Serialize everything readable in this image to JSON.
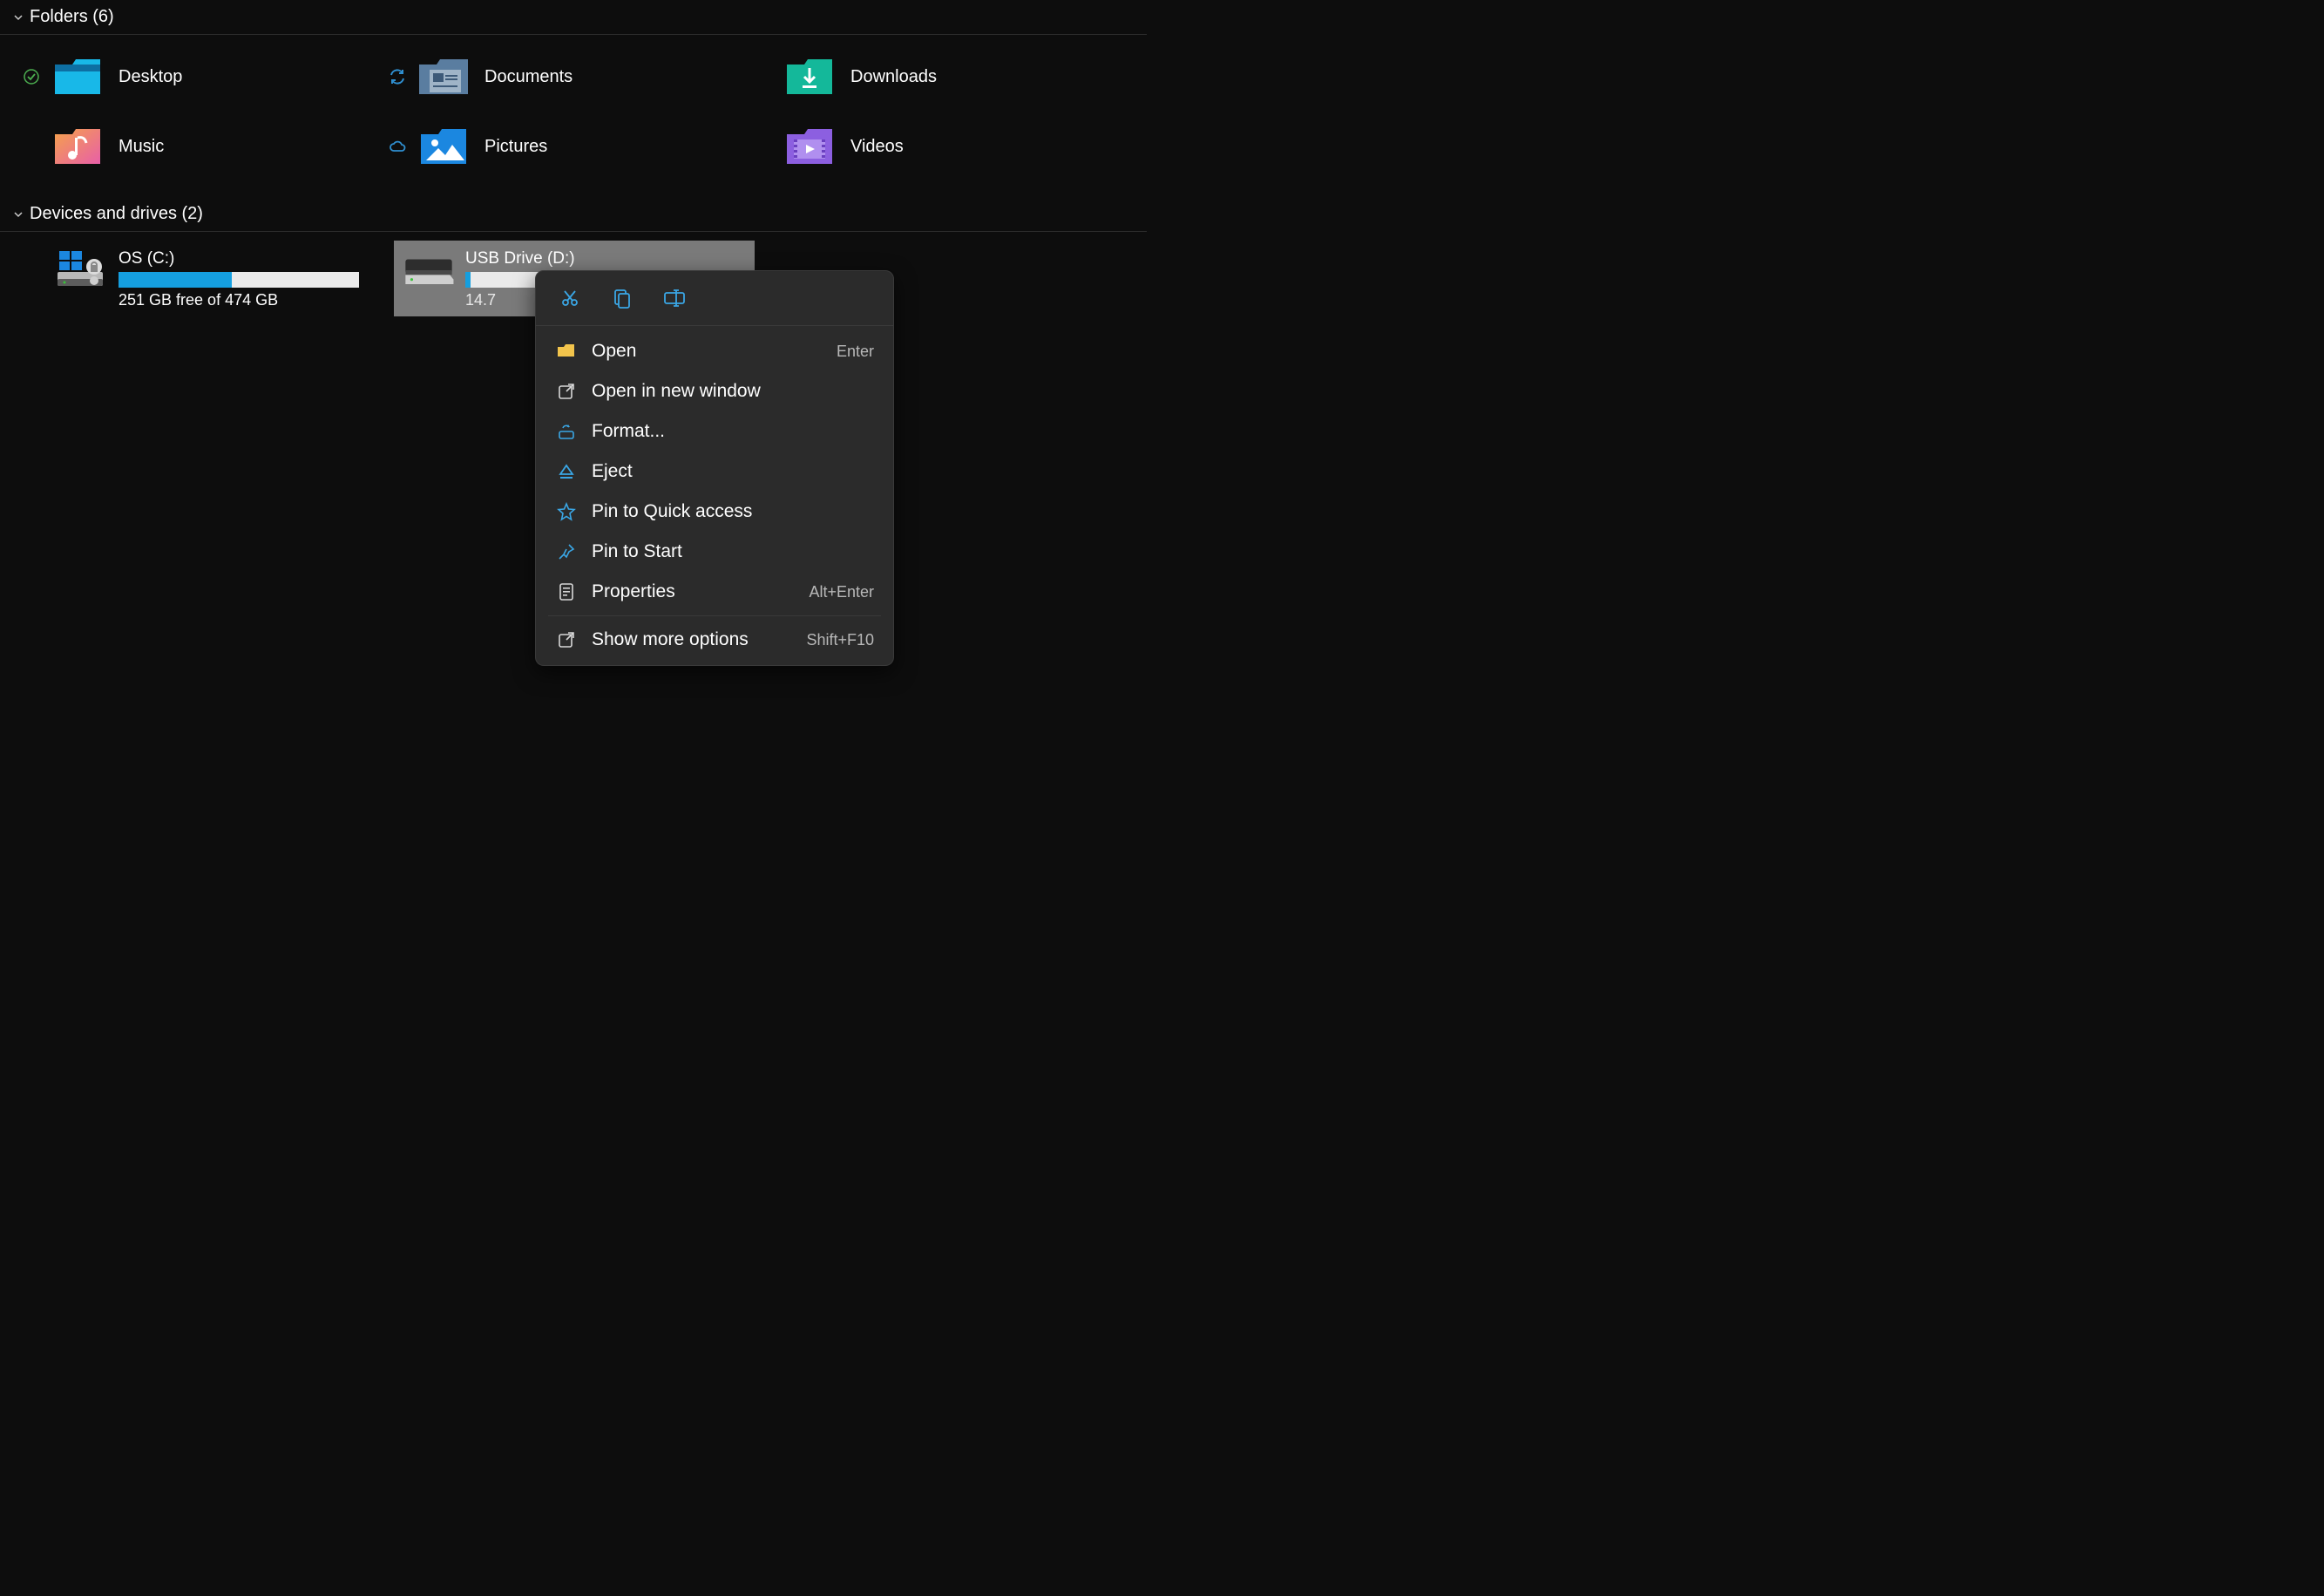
{
  "groups": {
    "folders": {
      "label": "Folders (6)"
    },
    "drives": {
      "label": "Devices and drives (2)"
    }
  },
  "folders": [
    {
      "name": "Desktop",
      "status": "synced"
    },
    {
      "name": "Documents",
      "status": "syncing"
    },
    {
      "name": "Downloads",
      "status": "none"
    },
    {
      "name": "Music",
      "status": "none"
    },
    {
      "name": "Pictures",
      "status": "cloud"
    },
    {
      "name": "Videos",
      "status": "none"
    }
  ],
  "drives": [
    {
      "name": "OS (C:)",
      "free_text": "251 GB free of 474 GB",
      "used_pct": 47,
      "selected": false
    },
    {
      "name": "USB Drive (D:)",
      "free_text": "14.7",
      "used_pct": 2,
      "selected": true
    }
  ],
  "context_menu": {
    "top": [
      "cut",
      "copy",
      "rename"
    ],
    "items": [
      {
        "icon": "folder-open",
        "label": "Open",
        "shortcut": "Enter"
      },
      {
        "icon": "open-external",
        "label": "Open in new window",
        "shortcut": ""
      },
      {
        "icon": "format",
        "label": "Format...",
        "shortcut": ""
      },
      {
        "icon": "eject",
        "label": "Eject",
        "shortcut": ""
      },
      {
        "icon": "star",
        "label": "Pin to Quick access",
        "shortcut": ""
      },
      {
        "icon": "pin",
        "label": "Pin to Start",
        "shortcut": ""
      },
      {
        "icon": "properties",
        "label": "Properties",
        "shortcut": "Alt+Enter"
      }
    ],
    "footer": {
      "icon": "more",
      "label": "Show more options",
      "shortcut": "Shift+F10"
    }
  }
}
